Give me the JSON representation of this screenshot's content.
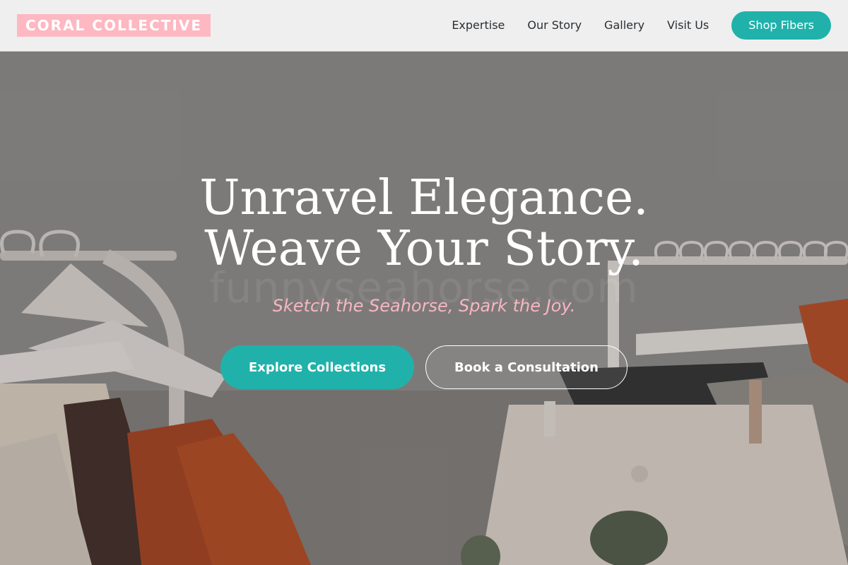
{
  "header": {
    "logo": "CORAL COLLECTIVE",
    "nav": [
      {
        "label": "Expertise"
      },
      {
        "label": "Our Story"
      },
      {
        "label": "Gallery"
      },
      {
        "label": "Visit Us"
      }
    ],
    "cta_label": "Shop Fibers"
  },
  "hero": {
    "headline_line1": "Unravel Elegance.",
    "headline_line2": "Weave Your Story.",
    "watermark": "funnyseahorse.com",
    "tagline": "Sketch the Seahorse, Spark the Joy.",
    "primary_button": "Explore Collections",
    "secondary_button": "Book a Consultation",
    "background_image": "clothing-rack-photo"
  },
  "colors": {
    "brand_pink": "#fdb8c2",
    "accent_teal": "#20b2aa",
    "tagline_pink": "#f7b6c2",
    "header_bg": "#efefef",
    "nav_text": "#2b2f33"
  }
}
